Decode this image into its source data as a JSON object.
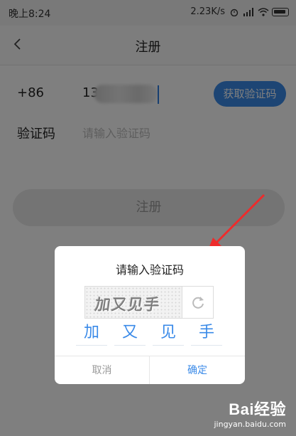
{
  "status_bar": {
    "time": "晚上8:24",
    "speed": "2.23K/s"
  },
  "nav": {
    "title": "注册"
  },
  "form": {
    "country_code": "+86",
    "phone_prefix": "13",
    "get_code_button": "获取验证码",
    "code_label": "验证码",
    "code_placeholder": "请输入验证码",
    "register_button": "注册"
  },
  "dialog": {
    "title": "请输入验证码",
    "captcha_image_text": "加又见手",
    "chars": [
      "加",
      "又",
      "见",
      "手"
    ],
    "cancel": "取消",
    "confirm": "确定"
  },
  "watermark": {
    "brand": "Bai经验",
    "url": "jingyan.baidu.com"
  },
  "colors": {
    "accent": "#3a8ae8",
    "arrow": "#ee2b2b",
    "overlay": "rgba(0,0,0,0.5)"
  }
}
